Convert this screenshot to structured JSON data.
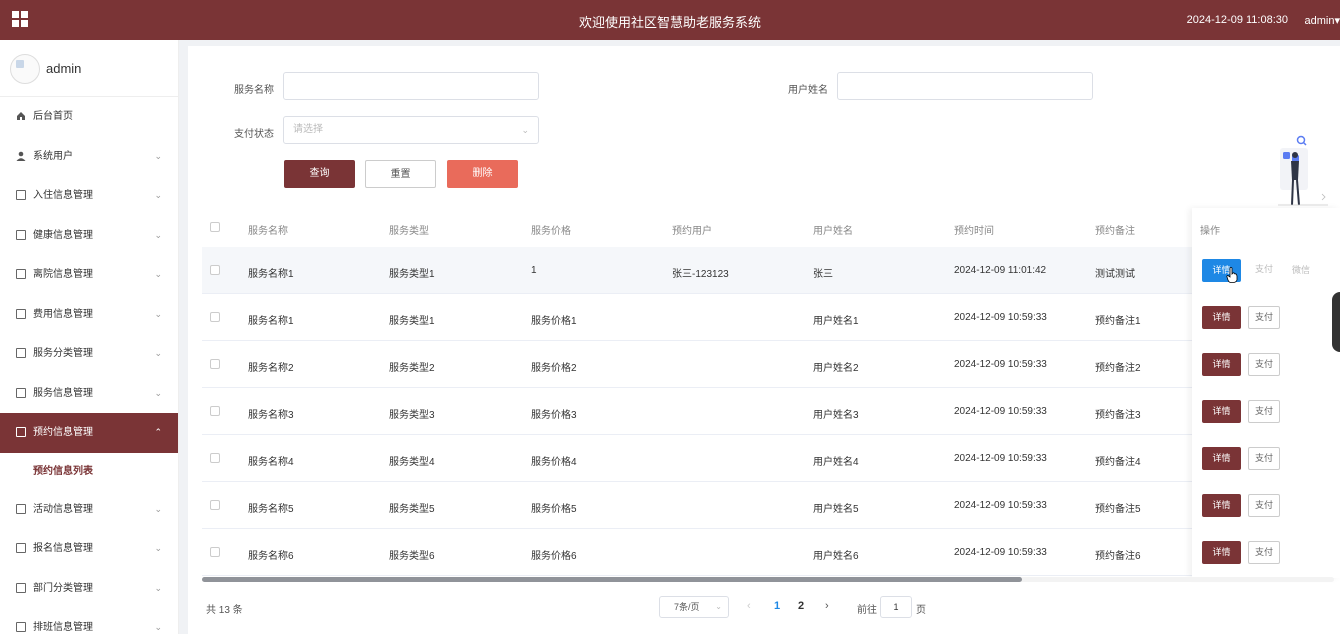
{
  "topbar": {
    "title": "欢迎使用社区智慧助老服务系统",
    "datetime": "2024-12-09 11:08:30",
    "user": "admin▾"
  },
  "sidebar": {
    "username": "admin",
    "items": [
      {
        "label": "后台首页",
        "icon": "home-icon"
      },
      {
        "label": "系统用户",
        "icon": "user-icon",
        "arrow": "⌄"
      },
      {
        "label": "入住信息管理",
        "icon": "document-icon",
        "arrow": "⌄"
      },
      {
        "label": "健康信息管理",
        "icon": "document-icon",
        "arrow": "⌄"
      },
      {
        "label": "离院信息管理",
        "icon": "document-icon",
        "arrow": "⌄"
      },
      {
        "label": "费用信息管理",
        "icon": "document-icon",
        "arrow": "⌄"
      },
      {
        "label": "服务分类管理",
        "icon": "document-icon",
        "arrow": "⌄"
      },
      {
        "label": "服务信息管理",
        "icon": "document-icon",
        "arrow": "⌄"
      },
      {
        "label": "预约信息管理",
        "icon": "document-icon",
        "arrow": "⌃",
        "active": true
      },
      {
        "label": "活动信息管理",
        "icon": "document-icon",
        "arrow": "⌄"
      },
      {
        "label": "报名信息管理",
        "icon": "document-icon",
        "arrow": "⌄"
      },
      {
        "label": "部门分类管理",
        "icon": "document-icon",
        "arrow": "⌄"
      },
      {
        "label": "排班信息管理",
        "icon": "document-icon",
        "arrow": "⌄"
      }
    ],
    "sub_item": "预约信息列表"
  },
  "search": {
    "service_name_label": "服务名称",
    "user_name_label": "用户姓名",
    "pay_status_label": "支付状态",
    "pay_status_placeholder": "请选择",
    "query_button": "查询",
    "reset_button": "重置",
    "delete_button": "删除"
  },
  "table": {
    "columns": [
      "服务名称",
      "服务类型",
      "服务价格",
      "预约用户",
      "用户姓名",
      "预约时间",
      "预约备注",
      "操作"
    ],
    "rows": [
      {
        "name": "服务名称1",
        "type": "服务类型1",
        "price": "1",
        "booker": "张三-123123",
        "user": "张三",
        "time": "2024-12-09 11:01:42",
        "remark": "测试测试"
      },
      {
        "name": "服务名称1",
        "type": "服务类型1",
        "price": "服务价格1",
        "booker": "",
        "user": "用户姓名1",
        "time": "2024-12-09 10:59:33",
        "remark": "预约备注1"
      },
      {
        "name": "服务名称2",
        "type": "服务类型2",
        "price": "服务价格2",
        "booker": "",
        "user": "用户姓名2",
        "time": "2024-12-09 10:59:33",
        "remark": "预约备注2"
      },
      {
        "name": "服务名称3",
        "type": "服务类型3",
        "price": "服务价格3",
        "booker": "",
        "user": "用户姓名3",
        "time": "2024-12-09 10:59:33",
        "remark": "预约备注3"
      },
      {
        "name": "服务名称4",
        "type": "服务类型4",
        "price": "服务价格4",
        "booker": "",
        "user": "用户姓名4",
        "time": "2024-12-09 10:59:33",
        "remark": "预约备注4"
      },
      {
        "name": "服务名称5",
        "type": "服务类型5",
        "price": "服务价格5",
        "booker": "",
        "user": "用户姓名5",
        "time": "2024-12-09 10:59:33",
        "remark": "预约备注5"
      },
      {
        "name": "服务名称6",
        "type": "服务类型6",
        "price": "服务价格6",
        "booker": "",
        "user": "用户姓名6",
        "time": "2024-12-09 10:59:33",
        "remark": "预约备注6"
      }
    ],
    "actions": {
      "detail": "详情",
      "pay": "支付",
      "wechat": "微信"
    }
  },
  "pagination": {
    "total": "共 13 条",
    "page_size": "7条/页",
    "pages": [
      "1",
      "2"
    ],
    "current_page": "1",
    "goto_label": "前往",
    "goto_value": "1",
    "goto_suffix": "页"
  },
  "colors": {
    "brand": "#7a3436",
    "delete": "#e96b5b",
    "active_blue": "#1e88e5"
  }
}
